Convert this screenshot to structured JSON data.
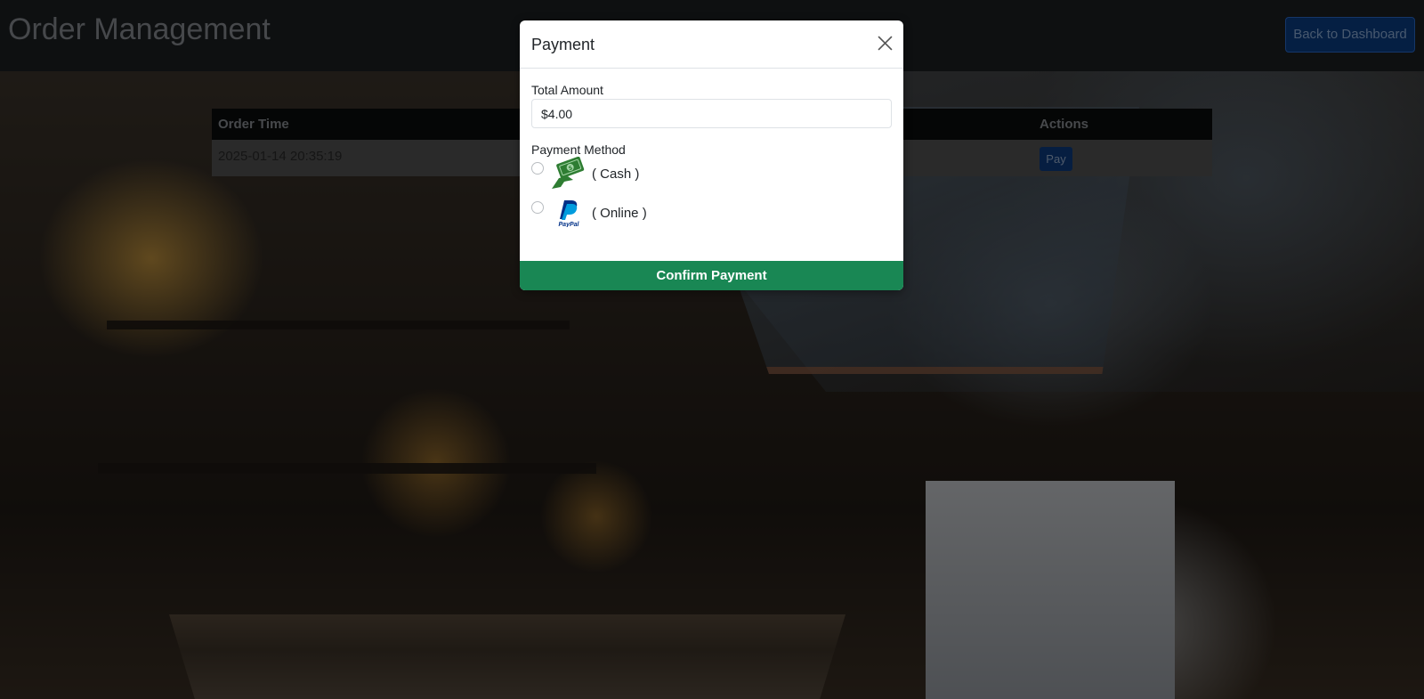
{
  "header": {
    "title": "Order Management",
    "back_button_label": "Back to Dashboard"
  },
  "orders_table": {
    "columns": [
      "Order Time",
      "Actions"
    ],
    "rows": [
      {
        "order_time": "2025-01-14 20:35:19",
        "action_label": "Pay"
      }
    ]
  },
  "payment_modal": {
    "title": "Payment",
    "total_amount_label": "Total Amount",
    "total_amount_value": "$4.00",
    "payment_method_label": "Payment Method",
    "options": [
      {
        "label": "( Cash )",
        "icon": "cash-icon",
        "selected": false
      },
      {
        "label": "( Online )",
        "icon": "paypal-icon",
        "selected": false
      }
    ],
    "confirm_label": "Confirm Payment"
  },
  "colors": {
    "navbar": "#1d2023",
    "primary": "#0d6efd",
    "success": "#198754"
  }
}
